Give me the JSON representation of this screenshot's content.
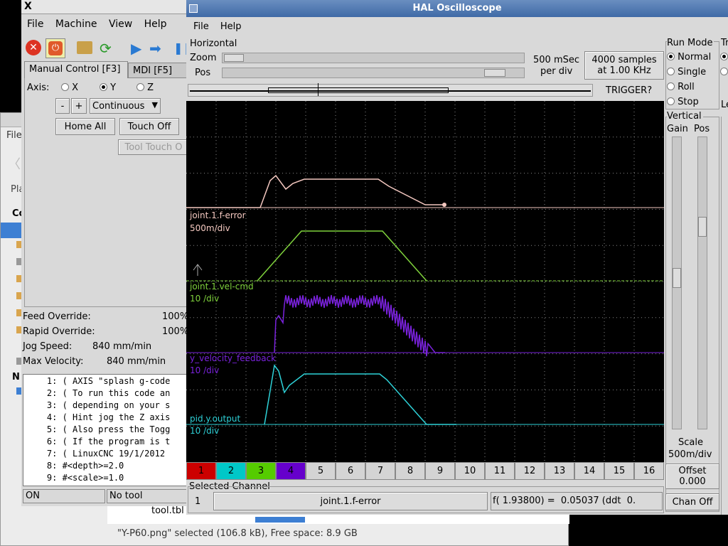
{
  "file_window": {
    "menu": "File",
    "label_pla": "Pla",
    "label_co": "Co",
    "label_n": "N",
    "file_name": "tool.tbl",
    "status": "\"Y-P60.png\" selected (106.8 kB), Free space: 8.9 GB"
  },
  "axis_window": {
    "title_glyph": "X",
    "menu": [
      "File",
      "Machine",
      "View",
      "Help"
    ],
    "tabs": [
      "Manual Control [F3]",
      "MDI [F5]"
    ],
    "axis_label": "Axis:",
    "axes": [
      "X",
      "Y",
      "Z"
    ],
    "selected_axis": "Y",
    "minus": "-",
    "plus": "+",
    "jog_mode": "Continuous",
    "home_all": "Home All",
    "touch_off": "Touch Off",
    "tool_touch": "Tool Touch O",
    "feed_override_label": "Feed Override:",
    "feed_override_value": "100%",
    "rapid_override_label": "Rapid Override:",
    "rapid_override_value": "100%",
    "jog_speed_label": "Jog Speed:",
    "jog_speed_value": "840 mm/min",
    "max_velocity_label": "Max Velocity:",
    "max_velocity_value": "840 mm/min",
    "code_lines": [
      {
        "n": "1:",
        "t": "( AXIS \"splash g-code"
      },
      {
        "n": "2:",
        "t": "( To run this code an"
      },
      {
        "n": "3:",
        "t": "( depending on your s"
      },
      {
        "n": "4:",
        "t": "( Hint jog the Z axis"
      },
      {
        "n": "5:",
        "t": "( Also press the Togg"
      },
      {
        "n": "6:",
        "t": "( If the program is t"
      },
      {
        "n": "7:",
        "t": "( LinuxCNC 19/1/2012"
      },
      {
        "n": "8:",
        "t": "#<depth>=2.0"
      },
      {
        "n": "9:",
        "t": "#<scale>=1.0"
      }
    ],
    "status_state": "ON",
    "status_tool": "No tool"
  },
  "scope": {
    "title": "HAL Oscilloscope",
    "menu": [
      "File",
      "Help"
    ],
    "horizontal_label": "Horizontal",
    "zoom_label": "Zoom",
    "pos_label": "Pos",
    "timebase_line1": "500 mSec",
    "timebase_line2": "per div",
    "samples_line1": "4000 samples",
    "samples_line2": "at 1.00 KHz",
    "trigger_button": "TRIGGER?",
    "run_mode_label": "Run Mode",
    "run_modes": [
      "Normal",
      "Single",
      "Roll",
      "Stop"
    ],
    "run_mode_selected": "Normal",
    "tr_label": "Tr",
    "le_label": "Le",
    "vertical_label": "Vertical",
    "gain_label": "Gain",
    "pos_v_label": "Pos",
    "scale_label": "Scale",
    "scale_value": "500m/div",
    "offset_label": "Offset",
    "offset_value": "0.000",
    "chan_off": "Chan Off",
    "channels": [
      "1",
      "2",
      "3",
      "4",
      "5",
      "6",
      "7",
      "8",
      "9",
      "10",
      "11",
      "12",
      "13",
      "14",
      "15",
      "16"
    ],
    "channel_colors": [
      "#cc0000",
      "#00c8c8",
      "#55cc00",
      "#6600cc"
    ],
    "selected_channel_label": "Selected Channel",
    "selected_channel_num": "1",
    "selected_channel_name": "joint.1.f-error",
    "readout": "f( 1.93800) =  0.05037 (ddt  0.",
    "traces": [
      {
        "name": "joint.1.f-error",
        "scale": "500m/div",
        "color": "#f4c8c0"
      },
      {
        "name": "joint.1.vel-cmd",
        "scale": "10 /div",
        "color": "#7fd23c"
      },
      {
        "name": "y_velocity_feedback",
        "scale": "10 /div",
        "color": "#7a22dd"
      },
      {
        "name": "pid.y.output",
        "scale": "10 /div",
        "color": "#2ed2d8"
      }
    ]
  }
}
